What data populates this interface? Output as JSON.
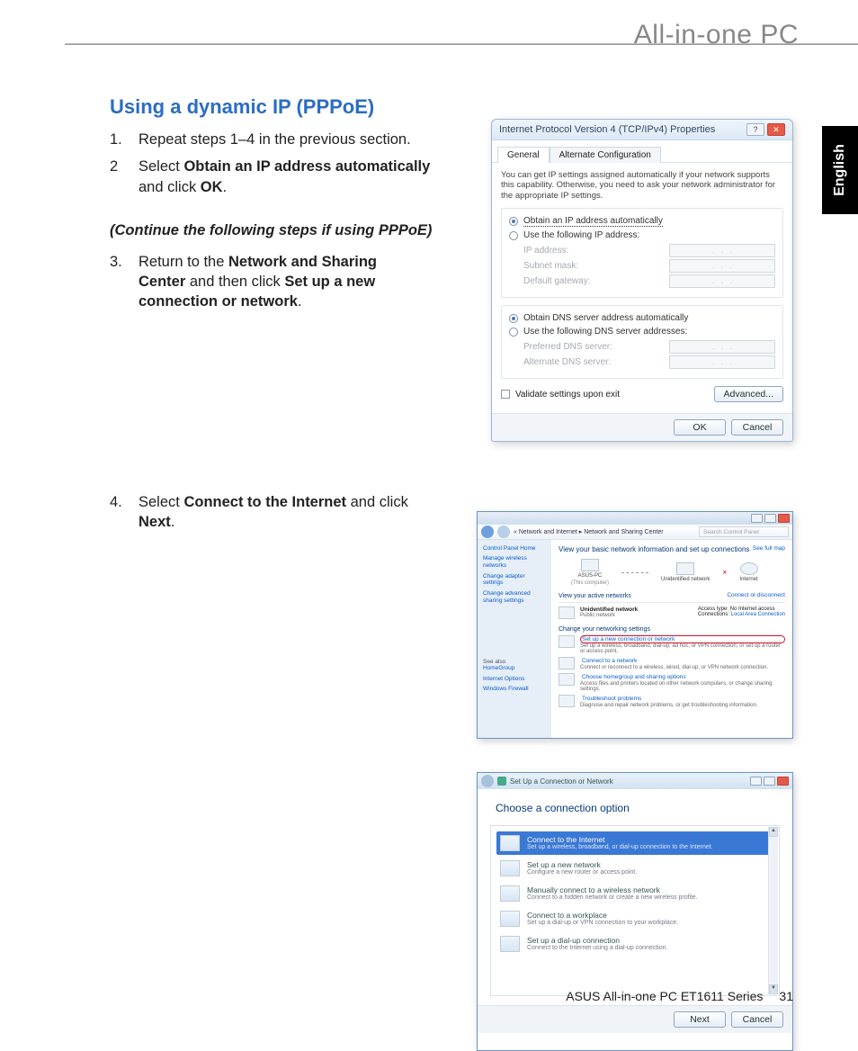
{
  "header": {
    "product_line": "All-in-one PC"
  },
  "language_tab": "English",
  "section_title": "Using a dynamic IP (PPPoE)",
  "steps12": [
    {
      "n": "1.",
      "text_before": "Repeat steps 1–4 in the previous section.",
      "bold1": "",
      "mid": "",
      "bold2": ""
    },
    {
      "n": "2",
      "text_before": "Select ",
      "bold1": "Obtain an IP address automatically",
      "mid": " and click ",
      "bold2": "OK",
      "after": "."
    }
  ],
  "subheading": "(Continue the following steps if using PPPoE)",
  "step3": {
    "n": "3.",
    "pre": "Return to the ",
    "b1": "Network and Sharing Center",
    "mid": " and then click ",
    "b2": "Set up a new connection or network",
    "after": "."
  },
  "step4": {
    "n": "4.",
    "pre": "Select ",
    "b1": "Connect to the Internet",
    "mid": " and click ",
    "b2": "Next",
    "after": "."
  },
  "dlg1": {
    "title": "Internet Protocol Version 4 (TCP/IPv4) Properties",
    "tabs": [
      "General",
      "Alternate Configuration"
    ],
    "info": "You can get IP settings assigned automatically if your network supports this capability. Otherwise, you need to ask your network administrator for the appropriate IP settings.",
    "r1": "Obtain an IP address automatically",
    "r2": "Use the following IP address:",
    "ip_label": "IP address:",
    "subnet_label": "Subnet mask:",
    "gateway_label": "Default gateway:",
    "r3": "Obtain DNS server address automatically",
    "r4": "Use the following DNS server addresses:",
    "pref_dns": "Preferred DNS server:",
    "alt_dns": "Alternate DNS server:",
    "validate": "Validate settings upon exit",
    "advanced": "Advanced...",
    "ok": "OK",
    "cancel": "Cancel",
    "help_glyph": "?"
  },
  "dlg2": {
    "breadcrumb": "« Network and Internet ▸ Network and Sharing Center",
    "search_placeholder": "Search Control Panel",
    "side_header": "Control Panel Home",
    "side_links": [
      "Manage wireless networks",
      "Change adapter settings",
      "Change advanced sharing settings"
    ],
    "seealso_hdr": "See also",
    "seealso": [
      "HomeGroup",
      "Internet Options",
      "Windows Firewall"
    ],
    "main_header": "View your basic network information and set up connections",
    "seefullmap": "See full map",
    "icons": {
      "pc": "ASUS-PC",
      "pc_sub": "(This computer)",
      "unid": "Unidentified network",
      "internet": "Internet"
    },
    "view_active": "View your active networks",
    "connect_disc": "Connect or disconnect",
    "active": {
      "name": "Unidentified network",
      "type": "Public network",
      "access_lbl": "Access type:",
      "access_val": "No Internet access",
      "conn_lbl": "Connections:",
      "conn_val": "Local Area Connection"
    },
    "change_hdr": "Change your networking settings",
    "links": [
      {
        "t": "Set up a new connection or network",
        "d": "Set up a wireless, broadband, dial-up, ad hoc, or VPN connection; or set up a router or access point."
      },
      {
        "t": "Connect to a network",
        "d": "Connect or reconnect to a wireless, wired, dial-up, or VPN network connection."
      },
      {
        "t": "Choose homegroup and sharing options",
        "d": "Access files and printers located on other network computers, or change sharing settings."
      },
      {
        "t": "Troubleshoot problems",
        "d": "Diagnose and repair network problems, or get troubleshooting information."
      }
    ]
  },
  "dlg3": {
    "title": "Set Up a Connection or Network",
    "heading": "Choose a connection option",
    "options": [
      {
        "t": "Connect to the Internet",
        "d": "Set up a wireless, broadband, or dial-up connection to the Internet."
      },
      {
        "t": "Set up a new network",
        "d": "Configure a new router or access point."
      },
      {
        "t": "Manually connect to a wireless network",
        "d": "Connect to a hidden network or create a new wireless profile."
      },
      {
        "t": "Connect to a workplace",
        "d": "Set up a dial-up or VPN connection to your workplace."
      },
      {
        "t": "Set up a dial-up connection",
        "d": "Connect to the Internet using a dial-up connection."
      }
    ],
    "next": "Next",
    "cancel": "Cancel"
  },
  "footer": {
    "product": "ASUS All-in-one PC  ET1611 Series",
    "page": "31"
  }
}
